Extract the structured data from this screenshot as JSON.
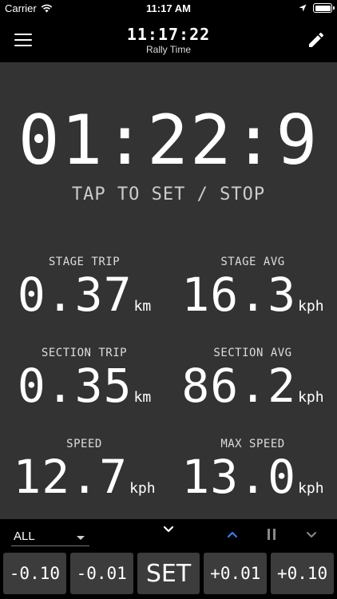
{
  "status_bar": {
    "carrier": "Carrier",
    "time": "11:17 AM",
    "icons": [
      "wifi-icon",
      "location-arrow-icon",
      "battery-icon"
    ]
  },
  "nav": {
    "title": "11:17:22",
    "subtitle": "Rally Time",
    "left_icon": "menu-icon",
    "right_icon": "pencil-icon"
  },
  "timer": {
    "value": "01:22:9",
    "hint": "TAP TO SET / STOP"
  },
  "metrics": {
    "stage_trip": {
      "label": "STAGE TRIP",
      "value": "0.37",
      "unit": "km"
    },
    "stage_avg": {
      "label": "STAGE AVG",
      "value": "16.3",
      "unit": "kph"
    },
    "section_trip": {
      "label": "SECTION TRIP",
      "value": "0.35",
      "unit": "km"
    },
    "section_avg": {
      "label": "SECTION AVG",
      "value": "86.2",
      "unit": "kph"
    },
    "speed": {
      "label": "SPEED",
      "value": "12.7",
      "unit": "kph"
    },
    "max_speed": {
      "label": "MAX SPEED",
      "value": "13.0",
      "unit": "kph"
    }
  },
  "controls": {
    "selector_value": "ALL",
    "icons": [
      "chevron-down-icon",
      "chevron-up-icon",
      "pause-icon",
      "chevron-down-icon"
    ],
    "buttons": [
      "-0.10",
      "-0.01",
      "SET",
      "+0.01",
      "+0.10"
    ]
  },
  "colors": {
    "background": "#000000",
    "panel": "#333333",
    "button": "#3c3c3c",
    "accent": "#3b82f6",
    "muted_icon": "#888888"
  }
}
